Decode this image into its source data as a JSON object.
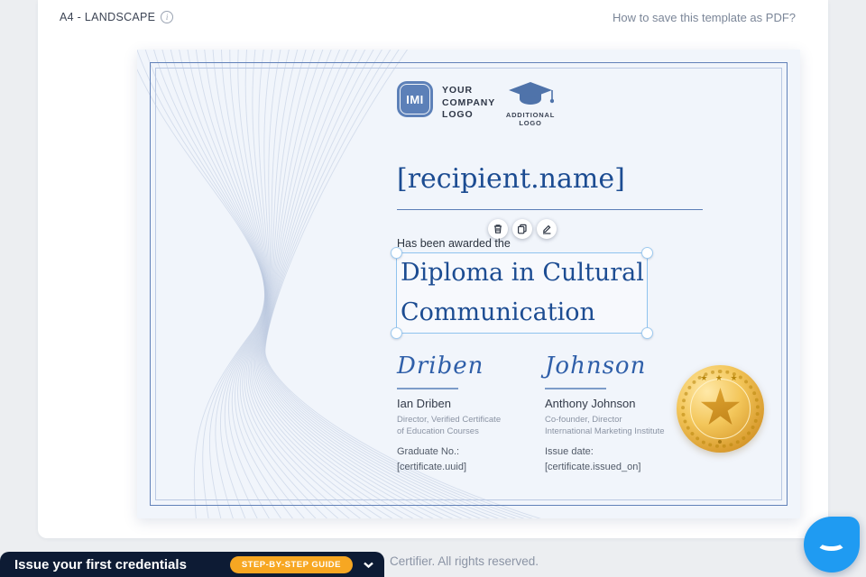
{
  "header": {
    "format_label": "A4 - LANDSCAPE",
    "help_link": "How to save this template as PDF?"
  },
  "certificate": {
    "logos": {
      "monogram": "IMI",
      "company_label": "YOUR\nCOMPANY\nLOGO",
      "additional_label": "ADDITIONAL LOGO"
    },
    "recipient_placeholder": "[recipient.name]",
    "awarded_line": "Has been awarded the",
    "title": "Diploma in Cultural Communication",
    "signatures": [
      {
        "script": "Driben",
        "name": "Ian Driben",
        "role": "Director, Verified Certificate\nof Education Courses"
      },
      {
        "script": "Johnson",
        "name": "Anthony Johnson",
        "role": "Co-founder, Director\nInternational Marketing Institute"
      }
    ],
    "fields": [
      {
        "label": "Graduate No.:",
        "value": "[certificate.uuid]"
      },
      {
        "label": "Issue date:",
        "value": "[certificate.issued_on]"
      }
    ],
    "badge": "gold-medal-star"
  },
  "selection_toolbar": {
    "buttons": [
      "delete",
      "duplicate",
      "edit"
    ]
  },
  "banner": {
    "title": "Issue your first credentials",
    "button_label": "STEP-BY-STEP GUIDE"
  },
  "footer": {
    "copyright": "Certifier. All rights reserved."
  },
  "colors": {
    "certificate_text_blue": "#1c4c92",
    "logo_blue": "#5c80b8",
    "selection_blue": "#8fc3ee",
    "script_blue": "#2f5fa9",
    "medal_gold": "#d89b2e",
    "banner_bg": "#0d1b34",
    "banner_button_orange": "#f7a722",
    "chat_blue": "#1f9bf2",
    "canvas_bg": "#f1f5fb"
  }
}
